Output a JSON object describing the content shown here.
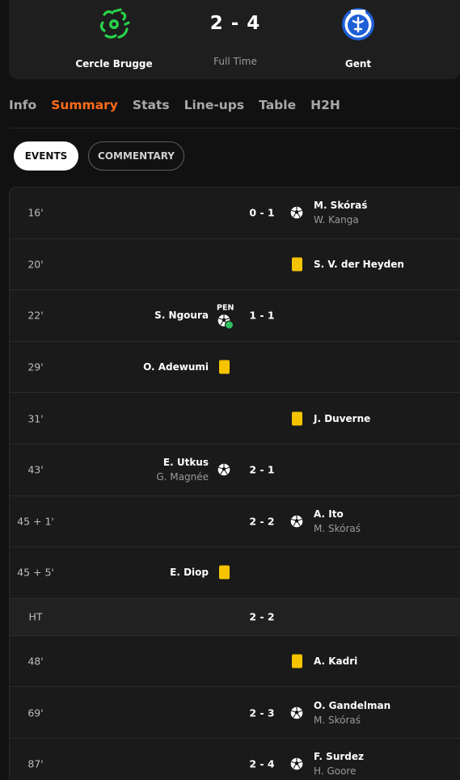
{
  "match": {
    "home_team": "Cercle Brugge",
    "away_team": "Gent",
    "score": "2 - 4",
    "status": "Full Time",
    "home_color": "#27d34a",
    "away_color": "#1f5fd6"
  },
  "tabs": [
    "Info",
    "Summary",
    "Stats",
    "Line-ups",
    "Table",
    "H2H"
  ],
  "active_tab": "Summary",
  "pills": {
    "events": "EVENTS",
    "commentary": "COMMENTARY"
  },
  "colors": {
    "accent": "#ff6b1a",
    "yellow_card": "#f5c400",
    "pen_check": "#2fbf60"
  },
  "events": [
    {
      "minute": "16'",
      "side": "away",
      "type": "goal",
      "score": "0 - 1",
      "player": "M. Skóraś",
      "assist": "W. Kanga"
    },
    {
      "minute": "20'",
      "side": "away",
      "type": "yellow-card",
      "player": "S. V. der Heyden"
    },
    {
      "minute": "22'",
      "side": "home",
      "type": "penalty-goal",
      "score": "1 - 1",
      "player": "S. Ngoura",
      "pen_label": "PEN"
    },
    {
      "minute": "29'",
      "side": "home",
      "type": "yellow-card",
      "player": "O. Adewumi"
    },
    {
      "minute": "31'",
      "side": "away",
      "type": "yellow-card",
      "player": "J. Duverne"
    },
    {
      "minute": "43'",
      "side": "home",
      "type": "goal",
      "score": "2 - 1",
      "player": "E. Utkus",
      "assist": "G. Magnée"
    },
    {
      "minute": "45 + 1'",
      "side": "away",
      "type": "goal",
      "score": "2 - 2",
      "player": "A. Ito",
      "assist": "M. Skóraś"
    },
    {
      "minute": "45 + 5'",
      "side": "home",
      "type": "yellow-card",
      "player": "E. Diop"
    },
    {
      "minute": "HT",
      "side": "none",
      "type": "half-time",
      "score": "2 - 2"
    },
    {
      "minute": "48'",
      "side": "away",
      "type": "yellow-card",
      "player": "A. Kadri"
    },
    {
      "minute": "69'",
      "side": "away",
      "type": "goal",
      "score": "2 - 3",
      "player": "O. Gandelman",
      "assist": "M. Skóraś"
    },
    {
      "minute": "87'",
      "side": "away",
      "type": "goal",
      "score": "2 - 4",
      "player": "F. Surdez",
      "assist": "H. Goore"
    }
  ]
}
